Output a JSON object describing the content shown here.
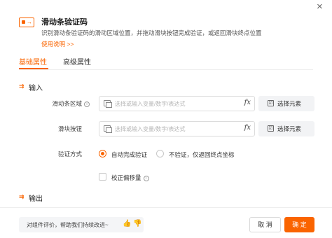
{
  "header": {
    "icon": "slider-captcha-icon",
    "title": "滑动条验证码",
    "description": "识别滑动条验证码的滑动区域位置，并拖动滑块按钮完成验证，或返回滑块终点位置",
    "help_link": "使用说明 >>",
    "close": "×"
  },
  "tabs": [
    {
      "label": "基础属性",
      "active": true
    },
    {
      "label": "高级属性",
      "active": false
    }
  ],
  "sections": {
    "input": {
      "icon": "input-section-icon",
      "title": "输入"
    },
    "output": {
      "icon": "output-section-icon",
      "title": "输出"
    }
  },
  "fields": {
    "slider_area": {
      "label": "滑动条区域",
      "info": "i",
      "placeholder": "选择或输入变量/数字/表达式",
      "fx": "fx",
      "select_button": "选择元素",
      "select_icon": "☑"
    },
    "slider_button": {
      "label": "滑块按钮",
      "placeholder": "选择或输入变量/数字/表达式",
      "fx": "fx",
      "select_button": "选择元素",
      "select_icon": "☑"
    },
    "verify_method": {
      "label": "验证方式",
      "options": [
        {
          "label": "自动完成验证",
          "checked": true
        },
        {
          "label": "不验证，仅返回终点坐标",
          "checked": false
        }
      ]
    },
    "correct_offset": {
      "label": "校正偏移量",
      "info": "i",
      "checked": false
    }
  },
  "footer": {
    "feedback_text": "对组件评价，帮助我们持续改进~",
    "thumb_up": "👍",
    "thumb_down": "👎",
    "cancel": "取 消",
    "ok": "确 定"
  },
  "colors": {
    "accent": "#fa6400",
    "button_bg": "#f2f3f5"
  }
}
